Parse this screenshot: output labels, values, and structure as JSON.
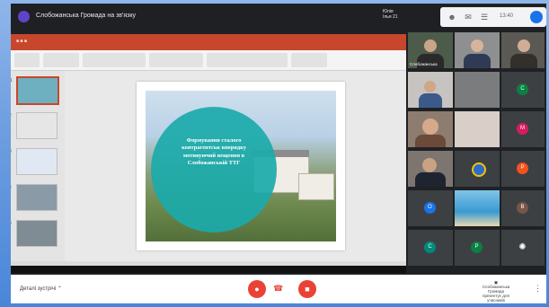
{
  "meeting": {
    "title": "Слобожанська Громада на зв'язку",
    "presenter_line1": "Юлія",
    "presenter_line2": "Ілья 21",
    "time": "13:40",
    "details_label": "Деталі зустрічі",
    "present_label_1": "Слобожанська Громада",
    "present_label_2": "презентує для учасників"
  },
  "presentation": {
    "slide_numbers": [
      "1",
      "2",
      "3",
      "4",
      "5"
    ],
    "slide_text": "Формування сталого контрагентськ впорядку мотивуючий вещення в Слобожанській ТТГ"
  },
  "participants": [
    {
      "name": "Слобожанська"
    },
    {
      "name": ""
    },
    {
      "name": ""
    },
    {
      "name": ""
    },
    {
      "name": ""
    },
    {
      "initial": "C",
      "color": "#0b8043"
    },
    {
      "name": ""
    },
    {
      "name": ""
    },
    {
      "initial": "M",
      "color": "#d81b60"
    },
    {
      "name": ""
    },
    {
      "name": ""
    },
    {
      "initial": "P",
      "color": "#f4511e"
    },
    {
      "initial": "O",
      "color": "#1a73e8"
    },
    {
      "name": ""
    },
    {
      "initial": "B",
      "color": "#795548"
    },
    {
      "initial": "C",
      "color": "#00897b"
    },
    {
      "initial": "P",
      "color": "#0b8043"
    },
    {
      "initial": "",
      "color": "#3c4043"
    }
  ],
  "colors": {
    "accent_red": "#ea4335",
    "ppt_orange": "#c8472c",
    "teal_circle": "#1baaaa"
  },
  "icons": {
    "end_call": "phone-hangup-icon",
    "mic": "mic-icon",
    "more": "more-vert-icon"
  }
}
